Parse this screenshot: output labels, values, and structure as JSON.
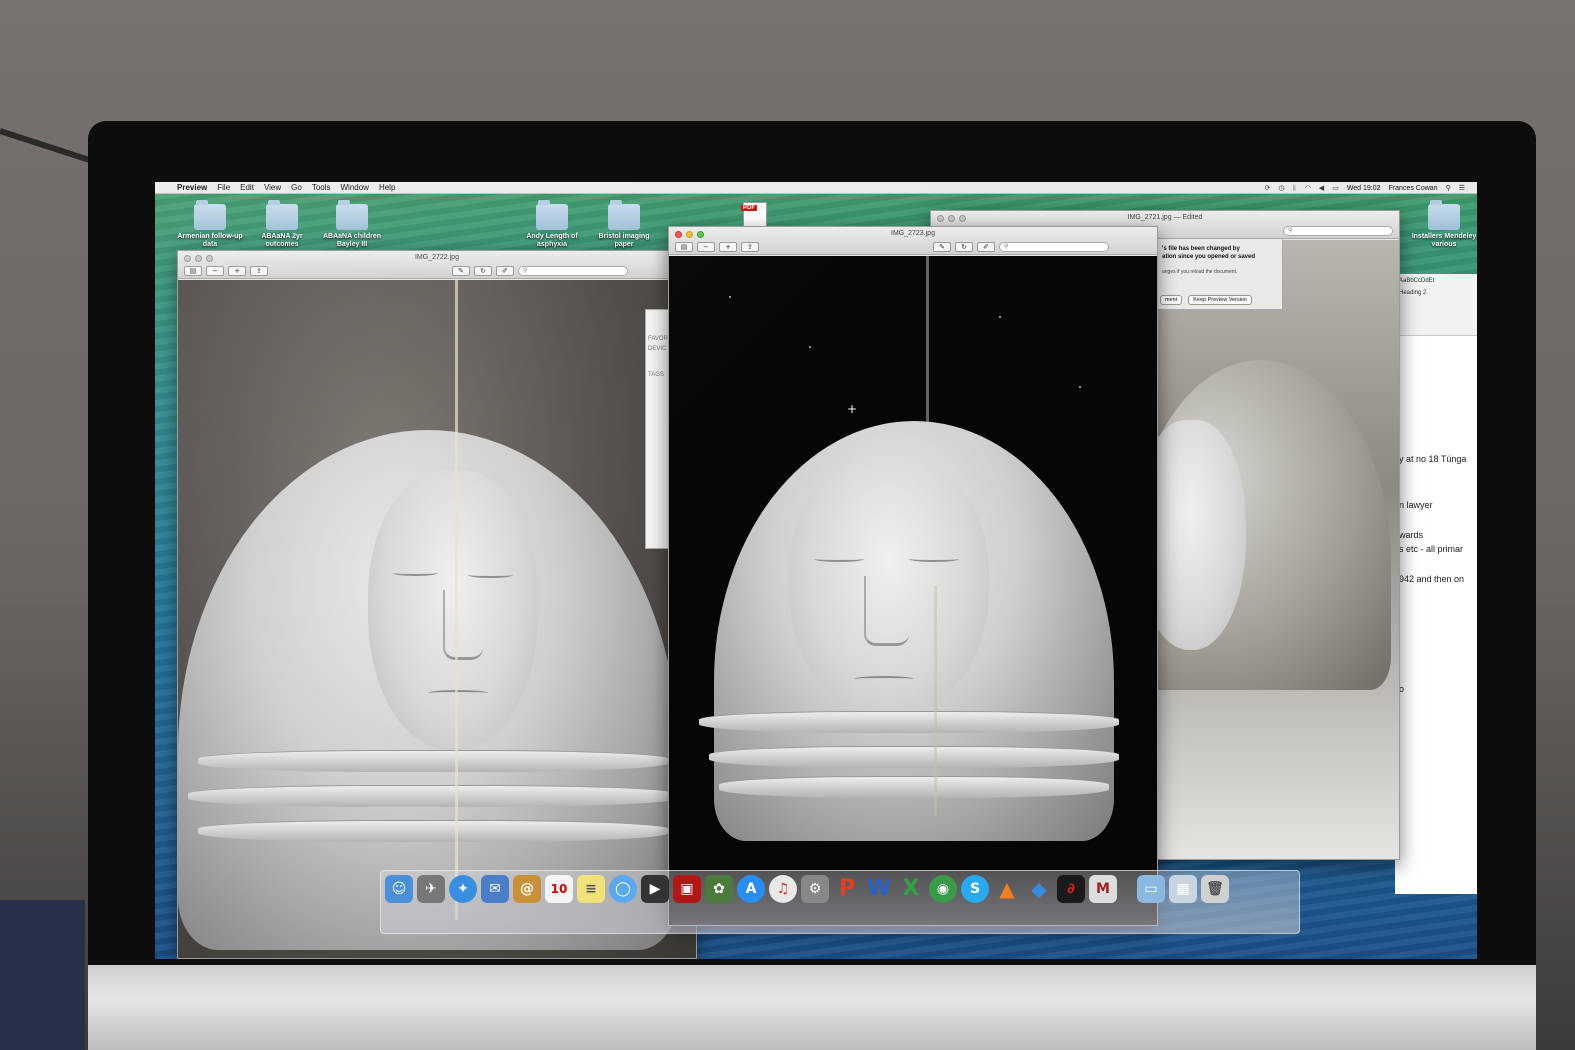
{
  "menubar": {
    "apple": "",
    "app_name": "Preview",
    "items": [
      "File",
      "Edit",
      "View",
      "Go",
      "Tools",
      "Window",
      "Help"
    ],
    "clock": "Wed 19:02",
    "user": "Frances Cowan"
  },
  "desktop": {
    "icons": [
      {
        "label": "Armenian follow-up data"
      },
      {
        "label": "ABAaNA 2yr outcomes"
      },
      {
        "label": "ABAaNA children Bayley III"
      },
      {
        "label": "Andy Length of asphyxia"
      },
      {
        "label": "Bristol imaging paper"
      },
      {
        "label": "Installers Mendeley various"
      }
    ],
    "pdf_tag": "PDF"
  },
  "windows": {
    "left": {
      "title": "IMG_2722.jpg"
    },
    "center": {
      "title": "IMG_2723.jpg"
    },
    "right": {
      "title": "IMG_2721.jpg",
      "subtitle": "— Edited"
    }
  },
  "finder": {
    "favorites": "FAVOR",
    "devices": "DEVIC",
    "tags": "TAGS"
  },
  "alert": {
    "line1": "'s file has been changed by",
    "line2": "ation since you opened or saved",
    "note": "anges if you reload the document.",
    "btn_left": "ment",
    "btn_keep": "Keep Preview Version"
  },
  "word": {
    "style": "AaBbCcDdEt",
    "heading": "Heading 2",
    "lines": [
      "y at no 18 Túnga",
      "n lawyer",
      "wards",
      "s etc  - all primar",
      "942 and then on",
      "o"
    ]
  },
  "dock": {
    "icons": [
      "finder-icon",
      "launchpad-icon",
      "safari-icon",
      "mail-icon",
      "contacts-icon",
      "calendar-icon",
      "notes-icon",
      "messages-icon",
      "facetime-icon",
      "photo-booth-icon",
      "iphoto-icon",
      "app-store-icon",
      "itunes-icon",
      "preferences-icon",
      "powerpoint-icon",
      "word-icon",
      "excel-icon",
      "maps-icon",
      "skype-icon",
      "vlc-icon",
      "dropbox-icon",
      "acrobat-icon",
      "mendeley-icon",
      "folder-icon",
      "downloads-icon",
      "trash-icon"
    ],
    "calendar_day": "10"
  },
  "colors": {
    "wallpaper_top": "#3f9c6a",
    "wallpaper_bottom": "#1a4f8a",
    "accent_red": "#d01010"
  }
}
